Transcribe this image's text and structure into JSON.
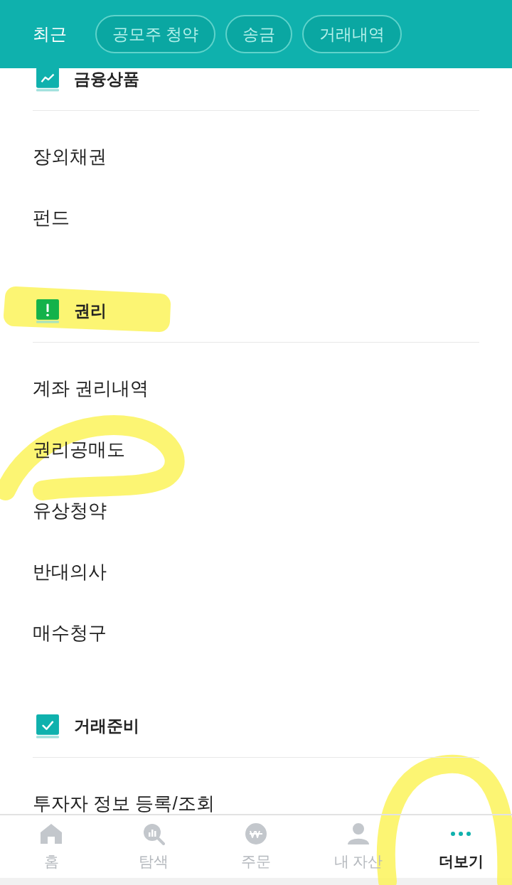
{
  "header": {
    "recent": "최근",
    "chips": [
      "공모주 청약",
      "송금",
      "거래내역"
    ]
  },
  "sections": [
    {
      "title": "금융상품",
      "kind": "chart",
      "items": [
        "장외채권",
        "펀드"
      ]
    },
    {
      "title": "권리",
      "kind": "alert",
      "items": [
        "계좌 권리내역",
        "권리공매도",
        "유상청약",
        "반대의사",
        "매수청구"
      ]
    },
    {
      "title": "거래준비",
      "kind": "check",
      "items": [
        "투자자 정보 등록/조회"
      ]
    }
  ],
  "nav": [
    {
      "label": "홈",
      "kind": "home",
      "selected": false
    },
    {
      "label": "탐색",
      "kind": "search",
      "selected": false
    },
    {
      "label": "주문",
      "kind": "won",
      "selected": false
    },
    {
      "label": "내 자산",
      "kind": "person",
      "selected": false
    },
    {
      "label": "더보기",
      "kind": "more",
      "selected": true
    }
  ]
}
